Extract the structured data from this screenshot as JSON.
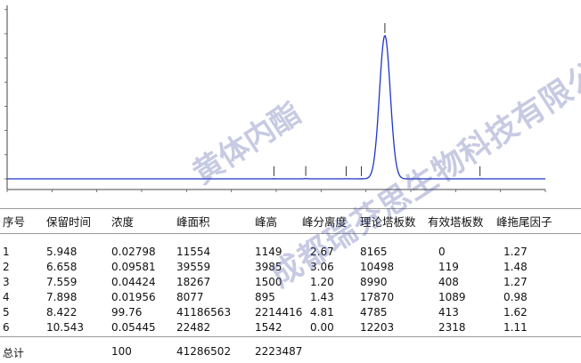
{
  "chart_data": {
    "type": "line",
    "xlim": [
      0,
      12
    ],
    "ylim": [
      0,
      1.45
    ],
    "peaks": [
      {
        "rt": 5.948,
        "area": 11554,
        "height": 1149
      },
      {
        "rt": 6.658,
        "area": 39559,
        "height": 3985
      },
      {
        "rt": 7.559,
        "area": 18267,
        "height": 1500
      },
      {
        "rt": 7.898,
        "area": 8077,
        "height": 895
      },
      {
        "rt": 8.422,
        "area": 41186563,
        "height": 2214416
      },
      {
        "rt": 10.543,
        "area": 22482,
        "height": 1542
      }
    ],
    "line_color": "#1f35c8",
    "baseline_color": "#2d3be0",
    "grid": false
  },
  "table": {
    "headers": [
      "序号",
      "保留时间",
      "浓度",
      "峰面积",
      "峰高",
      "峰分离度",
      "理论塔板数",
      "有效塔板数",
      "峰拖尾因子"
    ],
    "rows": [
      [
        "1",
        "5.948",
        "0.02798",
        "11554",
        "1149",
        "2.67",
        "8165",
        "0",
        "1.27"
      ],
      [
        "2",
        "6.658",
        "0.09581",
        "39559",
        "3985",
        "3.06",
        "10498",
        "119",
        "1.48"
      ],
      [
        "3",
        "7.559",
        "0.04424",
        "18267",
        "1500",
        "1.20",
        "8990",
        "408",
        "1.27"
      ],
      [
        "4",
        "7.898",
        "0.01956",
        "8077",
        "895",
        "1.43",
        "17870",
        "1089",
        "0.98"
      ],
      [
        "5",
        "8.422",
        "99.76",
        "41186563",
        "2214416",
        "4.81",
        "4785",
        "413",
        "1.62"
      ],
      [
        "6",
        "10.543",
        "0.05445",
        "22482",
        "1542",
        "0.00",
        "12203",
        "2318",
        "1.11"
      ]
    ],
    "total": [
      "总计",
      "",
      "100",
      "41286502",
      "2223487",
      "",
      "",
      "",
      ""
    ]
  },
  "watermarks": [
    "黄体内酯",
    "成都瑞芬思生物科技有限公司"
  ]
}
